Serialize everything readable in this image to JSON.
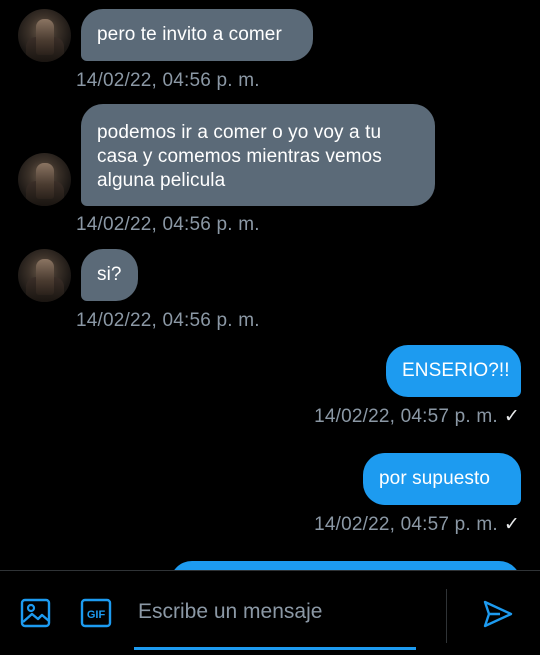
{
  "messages": [
    {
      "text": "pero te invito a comer",
      "time": "14/02/22, 04:56 p. m."
    },
    {
      "text": "podemos ir a comer o yo voy a tu casa y comemos mientras vemos alguna pelicula",
      "time": "14/02/22, 04:56 p. m."
    },
    {
      "text": "si?",
      "time": "14/02/22, 04:56 p. m."
    },
    {
      "text": "ENSERIO?!!",
      "time": "14/02/22, 04:57 p. m.",
      "status": "✓"
    },
    {
      "text": "por supuesto",
      "time": "14/02/22, 04:57 p. m.",
      "status": "✓"
    },
    {
      "text": ""
    }
  ],
  "composer": {
    "placeholder": "Escribe un mensaje",
    "gif_label": "GIF",
    "icons": [
      "image-icon",
      "gif-icon",
      "send-icon"
    ]
  },
  "colors": {
    "accent": "#1d9bf0",
    "incoming_bubble": "#5b6a78",
    "background": "#000000",
    "timestamp": "#8b98a5"
  }
}
